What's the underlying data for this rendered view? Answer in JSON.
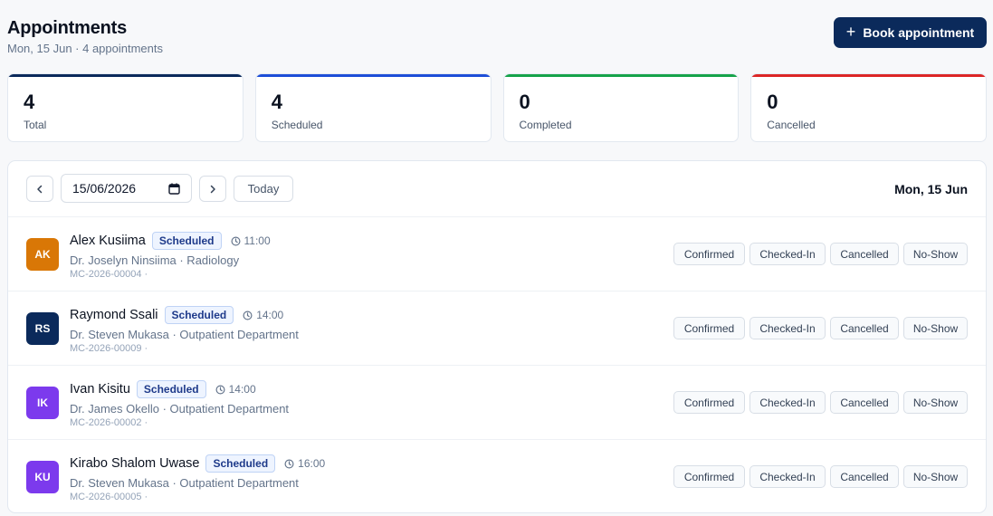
{
  "header": {
    "title": "Appointments",
    "subtitle": "Mon, 15 Jun · 4 appointments",
    "book_button": "Book appointment"
  },
  "stats": [
    {
      "value": "4",
      "label": "Total",
      "color": "#0b2a5b"
    },
    {
      "value": "4",
      "label": "Scheduled",
      "color": "#1d4ed8"
    },
    {
      "value": "0",
      "label": "Completed",
      "color": "#16a34a"
    },
    {
      "value": "0",
      "label": "Cancelled",
      "color": "#dc2626"
    }
  ],
  "toolbar": {
    "date_value": "15/06/2026",
    "today_label": "Today",
    "date_heading": "Mon, 15 Jun"
  },
  "appointments": [
    {
      "initials": "AK",
      "avatar_color": "#d97706",
      "name": "Alex Kusiima",
      "status": "Scheduled",
      "time": "11:00",
      "doctor_dept": "Dr. Joselyn Ninsiima · Radiology",
      "ref": "MC-2026-00004 ·"
    },
    {
      "initials": "RS",
      "avatar_color": "#0b2a5b",
      "name": "Raymond Ssali",
      "status": "Scheduled",
      "time": "14:00",
      "doctor_dept": "Dr. Steven Mukasa · Outpatient Department",
      "ref": "MC-2026-00009 ·"
    },
    {
      "initials": "IK",
      "avatar_color": "#7c3aed",
      "name": "Ivan Kisitu",
      "status": "Scheduled",
      "time": "14:00",
      "doctor_dept": "Dr. James Okello · Outpatient Department",
      "ref": "MC-2026-00002 ·"
    },
    {
      "initials": "KU",
      "avatar_color": "#7c3aed",
      "name": "Kirabo Shalom Uwase",
      "status": "Scheduled",
      "time": "16:00",
      "doctor_dept": "Dr. Steven Mukasa · Outpatient Department",
      "ref": "MC-2026-00005 ·"
    }
  ],
  "actions": {
    "confirmed": "Confirmed",
    "checked_in": "Checked-In",
    "cancelled": "Cancelled",
    "no_show": "No-Show"
  },
  "icons": {
    "prev": "chevron-left-icon",
    "next": "chevron-right-icon",
    "calendar": "calendar-icon",
    "clock": "clock-icon",
    "plus": "plus-icon"
  }
}
